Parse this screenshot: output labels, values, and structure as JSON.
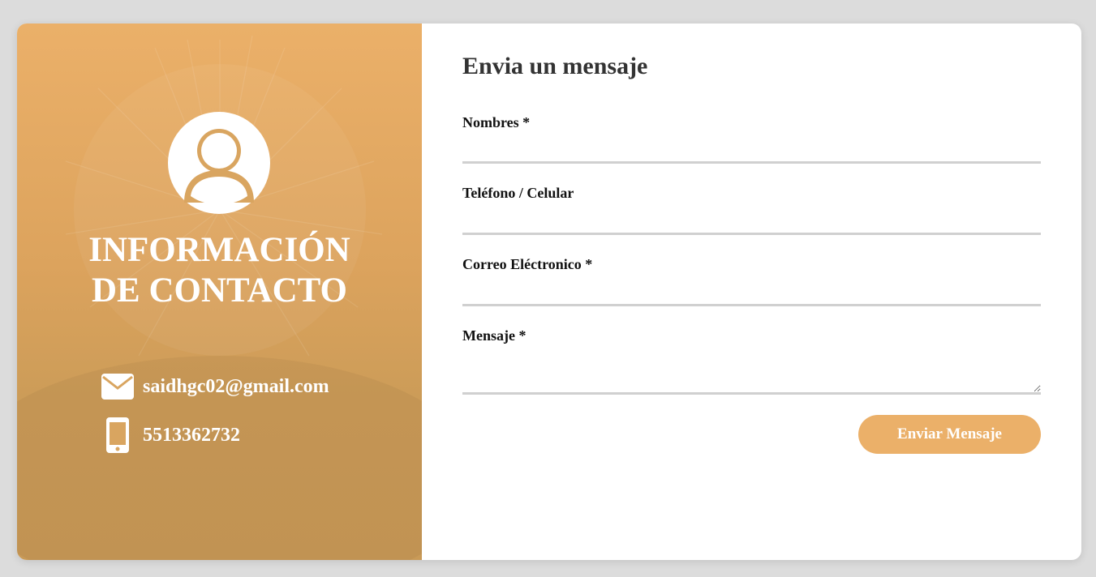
{
  "info": {
    "title_line1": "INFORMACIÓN",
    "title_line2": "DE CONTACTO",
    "email": "saidhgc02@gmail.com",
    "phone": "5513362732",
    "avatar_icon": "user-icon",
    "email_icon": "envelope-icon",
    "phone_icon": "smartphone-icon"
  },
  "form": {
    "title": "Envia un mensaje",
    "fields": [
      {
        "label": "Nombres *",
        "value": ""
      },
      {
        "label": "Teléfono / Celular",
        "value": ""
      },
      {
        "label": "Correo Eléctronico *",
        "value": ""
      },
      {
        "label": "Mensaje *",
        "value": ""
      }
    ],
    "submit_label": "Enviar Mensaje"
  },
  "colors": {
    "accent": "#ebb069",
    "panel_bottom": "#c99a57",
    "title_text": "#333333",
    "input_border": "#d0d0d0",
    "page_background": "#dcdcdc"
  }
}
